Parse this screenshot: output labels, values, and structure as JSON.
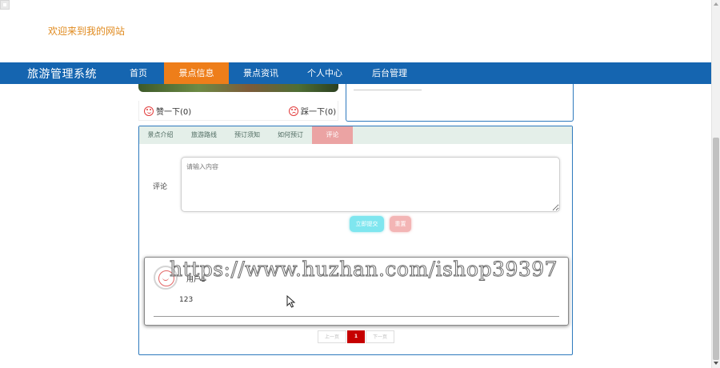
{
  "welcome": "欢迎来到我的网站",
  "nav": {
    "brand": "旅游管理系统",
    "items": [
      {
        "label": "首页"
      },
      {
        "label": "景点信息"
      },
      {
        "label": "景点资讯"
      },
      {
        "label": "个人中心"
      },
      {
        "label": "后台管理"
      }
    ],
    "active_index": 1
  },
  "votes": {
    "like_label": "赞一下(0)",
    "dislike_label": "踩一下(0)"
  },
  "tabs": [
    {
      "label": "景点介绍"
    },
    {
      "label": "旅游路线"
    },
    {
      "label": "预订须知"
    },
    {
      "label": "如何预订"
    },
    {
      "label": "评论"
    }
  ],
  "comment_form": {
    "label": "评论",
    "placeholder": "请输入内容",
    "submit_label": "立即提交",
    "reset_label": "重置"
  },
  "comments": [
    {
      "username": "用户1",
      "text": "123"
    }
  ],
  "pagination": {
    "prev_label": "上一页",
    "current_page": "1",
    "next_label": "下一页"
  },
  "watermark": "https://www.huzhan.com/ishop39397",
  "colors": {
    "nav_bg": "#1565b0",
    "nav_active": "#ee7e1a",
    "welcome_text": "#e08a1e",
    "tab_active": "#eba3a3",
    "submit_btn": "#7fe6ef",
    "reset_btn": "#f3b5b5",
    "pager_active": "#c60000"
  }
}
